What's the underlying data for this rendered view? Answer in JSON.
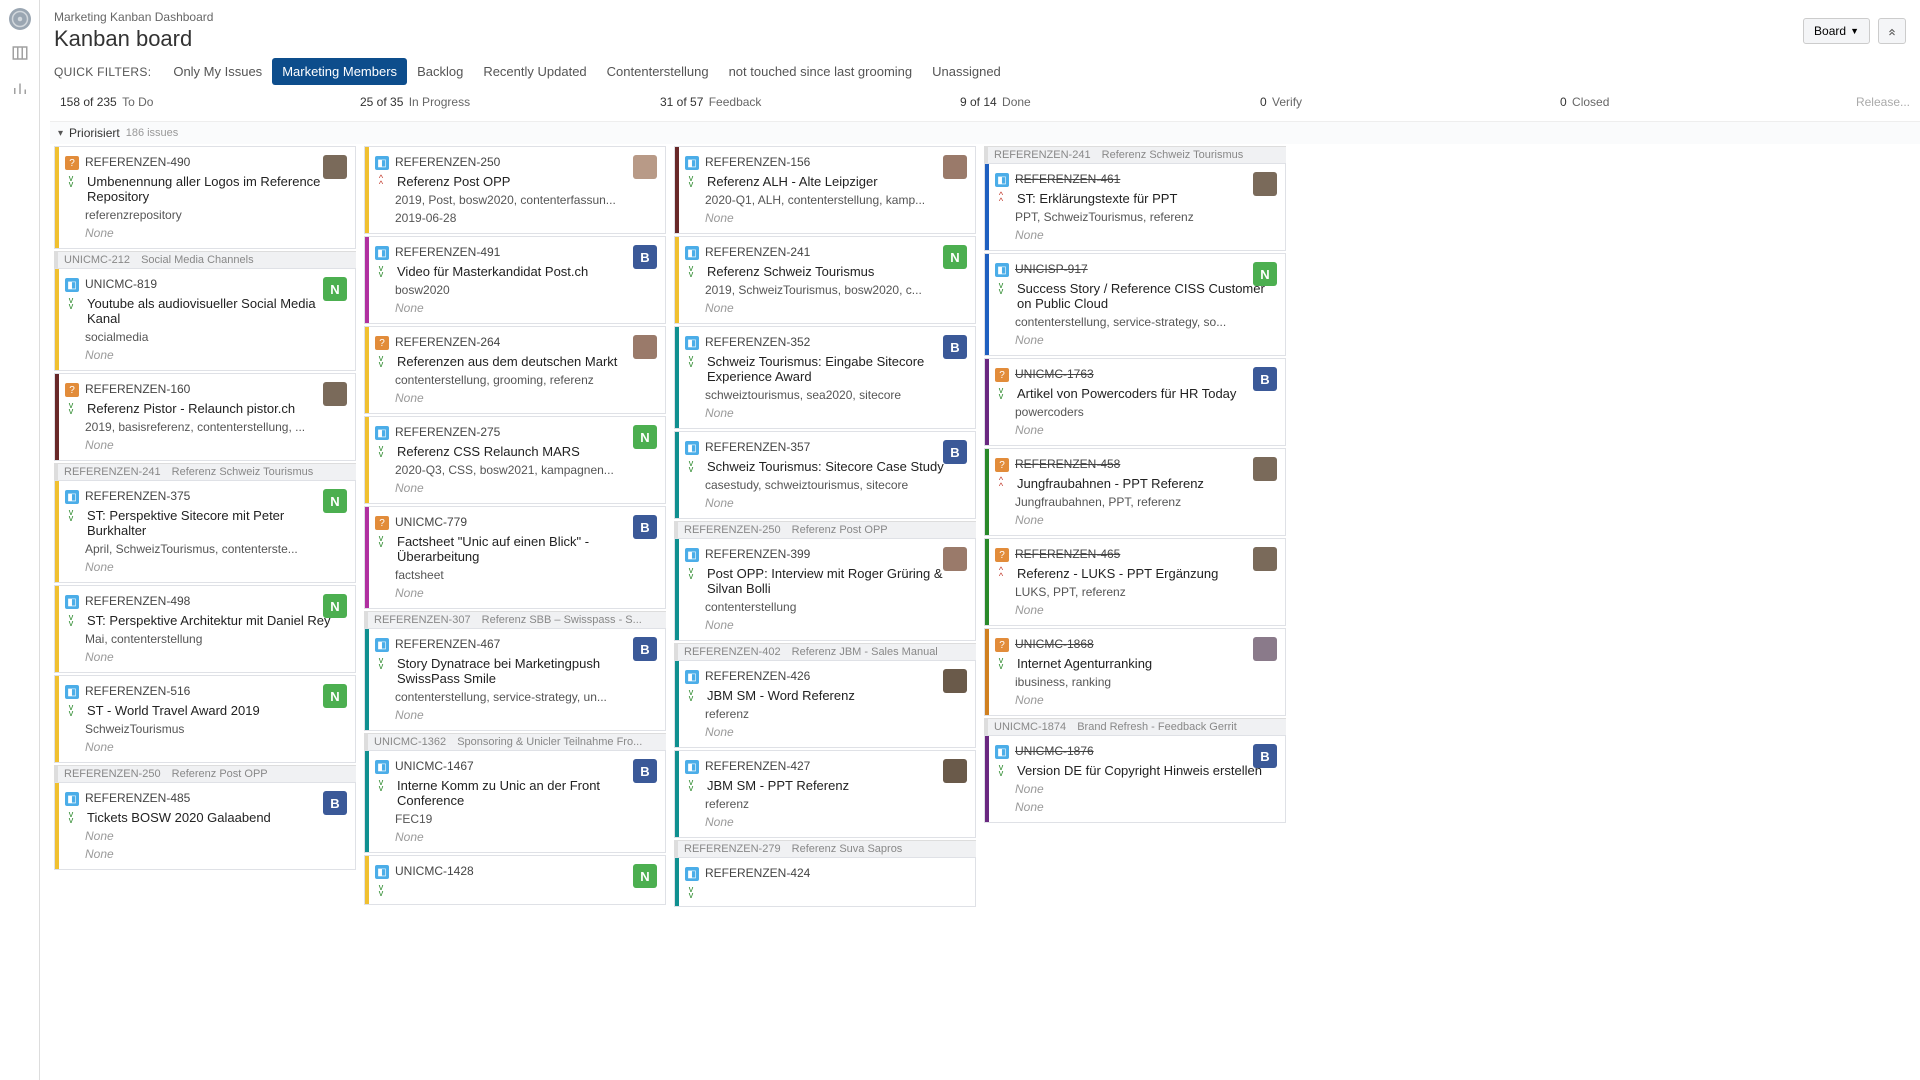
{
  "breadcrumb": "Marketing Kanban Dashboard",
  "page_title": "Kanban board",
  "board_menu": "Board",
  "filters_label": "QUICK FILTERS:",
  "filters": [
    {
      "label": "Only My Issues",
      "active": false
    },
    {
      "label": "Marketing Members",
      "active": true
    },
    {
      "label": "Backlog",
      "active": false
    },
    {
      "label": "Recently Updated",
      "active": false
    },
    {
      "label": "Contenterstellung",
      "active": false
    },
    {
      "label": "not touched since last grooming",
      "active": false
    },
    {
      "label": "Unassigned",
      "active": false
    }
  ],
  "columns": [
    {
      "count": "158 of 235",
      "name": "To Do"
    },
    {
      "count": "25 of 35",
      "name": "In Progress"
    },
    {
      "count": "31 of 57",
      "name": "Feedback"
    },
    {
      "count": "9 of 14",
      "name": "Done"
    },
    {
      "count": "0",
      "name": "Verify"
    },
    {
      "count": "0",
      "name": "Closed"
    }
  ],
  "release": "Release...",
  "swimlane": {
    "title": "Priorisiert",
    "count": "186 issues"
  },
  "cards": {
    "todo": [
      {
        "lane": "lane-yellow",
        "type": "task",
        "key": "REFERENZEN-490",
        "prio": "lowest",
        "summary": "Umbenennung aller Logos im Reference Repository",
        "tags": "referenzrepository",
        "none": "None",
        "avatar": {
          "cls": "photo2",
          "t": ""
        }
      },
      {
        "swimlabel": {
          "key": "UNICMC-212",
          "title": "Social Media Channels"
        },
        "lane": "lane-yellow",
        "type": "story",
        "key": "UNICMC-819",
        "prio": "lowest",
        "summary": "Youtube als audiovisueller Social Media Kanal",
        "tags": "socialmedia",
        "none": "None",
        "avatar": {
          "cls": "letter-N",
          "t": "N"
        }
      },
      {
        "lane": "lane-maroon",
        "type": "task",
        "key": "REFERENZEN-160",
        "prio": "lowest",
        "summary": "Referenz Pistor - Relaunch pistor.ch",
        "tags": "2019, basisreferenz, contenterstellung, ...",
        "none": "None",
        "avatar": {
          "cls": "photo2",
          "t": ""
        }
      },
      {
        "swimlabel": {
          "key": "REFERENZEN-241",
          "title": "Referenz Schweiz Tourismus"
        },
        "lane": "lane-yellow",
        "type": "story",
        "key": "REFERENZEN-375",
        "prio": "lowest",
        "summary": "ST: Perspektive Sitecore mit Peter Burkhalter",
        "tags": "April, SchweizTourismus, contenterste...",
        "none": "None",
        "avatar": {
          "cls": "letter-N",
          "t": "N"
        }
      },
      {
        "lane": "lane-yellow",
        "type": "story",
        "key": "REFERENZEN-498",
        "prio": "lowest",
        "summary": "ST: Perspektive Architektur mit Daniel Rey",
        "tags": "Mai, contenterstellung",
        "none": "None",
        "avatar": {
          "cls": "letter-N",
          "t": "N"
        }
      },
      {
        "lane": "lane-yellow",
        "type": "story",
        "key": "REFERENZEN-516",
        "prio": "lowest",
        "summary": "ST - World Travel Award 2019",
        "tags": "SchweizTourismus",
        "none": "None",
        "avatar": {
          "cls": "letter-N",
          "t": "N"
        }
      },
      {
        "swimlabel": {
          "key": "REFERENZEN-250",
          "title": "Referenz Post OPP"
        },
        "lane": "lane-yellow",
        "type": "story",
        "key": "REFERENZEN-485",
        "prio": "lowest",
        "summary": "Tickets BOSW 2020 Galaabend",
        "tags": "",
        "none": "None",
        "avatar": {
          "cls": "letter-B",
          "t": "B"
        },
        "none2": "None"
      }
    ],
    "inprogress": [
      {
        "lane": "lane-yellow",
        "type": "story",
        "key": "REFERENZEN-250",
        "prio": "highest",
        "summary": "Referenz Post OPP",
        "tags": "2019, Post, bosw2020, contenterfassun...",
        "none": "2019-06-28",
        "avatar": {
          "cls": "photo1",
          "t": ""
        }
      },
      {
        "lane": "lane-magenta",
        "type": "story",
        "key": "REFERENZEN-491",
        "prio": "lowest",
        "summary": "Video für Masterkandidat Post.ch",
        "tags": "bosw2020",
        "none": "None",
        "avatar": {
          "cls": "letter-B",
          "t": "B"
        }
      },
      {
        "lane": "lane-yellow",
        "type": "task",
        "key": "REFERENZEN-264",
        "prio": "lowest",
        "summary": "Referenzen aus dem deutschen Markt",
        "tags": "contenterstellung, grooming, referenz",
        "none": "None",
        "avatar": {
          "cls": "photo3",
          "t": ""
        }
      },
      {
        "lane": "lane-yellow",
        "type": "story",
        "key": "REFERENZEN-275",
        "prio": "lowest",
        "summary": "Referenz CSS Relaunch MARS",
        "tags": "2020-Q3, CSS, bosw2021, kampagnen...",
        "none": "None",
        "avatar": {
          "cls": "letter-N",
          "t": "N"
        }
      },
      {
        "lane": "lane-magenta",
        "type": "task",
        "key": "UNICMC-779",
        "prio": "lowest",
        "summary": "Factsheet \"Unic auf einen Blick\" - Überarbeitung",
        "tags": "factsheet",
        "none": "None",
        "avatar": {
          "cls": "letter-B",
          "t": "B"
        }
      },
      {
        "swimlabel": {
          "key": "REFERENZEN-307",
          "title": "Referenz SBB – Swisspass - S..."
        },
        "lane": "lane-teal",
        "type": "story",
        "key": "REFERENZEN-467",
        "prio": "lowest",
        "summary": "Story Dynatrace bei Marketingpush SwissPass Smile",
        "tags": "contenterstellung, service-strategy, un...",
        "none": "None",
        "avatar": {
          "cls": "letter-B",
          "t": "B"
        }
      },
      {
        "swimlabel": {
          "key": "UNICMC-1362",
          "title": "Sponsoring & Unicler Teilnahme Fro..."
        },
        "lane": "lane-teal",
        "type": "story",
        "key": "UNICMC-1467",
        "prio": "lowest",
        "summary": "Interne Komm zu Unic an der Front Conference",
        "tags": "FEC19",
        "none": "None",
        "avatar": {
          "cls": "letter-B",
          "t": "B"
        }
      },
      {
        "lane": "lane-yellow",
        "type": "story",
        "key": "UNICMC-1428",
        "prio": "lowest",
        "summary": "",
        "tags": "",
        "none": "",
        "avatar": {
          "cls": "letter-N",
          "t": "N"
        }
      }
    ],
    "feedback": [
      {
        "lane": "lane-maroon",
        "type": "story",
        "key": "REFERENZEN-156",
        "prio": "lowest",
        "summary": "Referenz ALH - Alte Leipziger",
        "tags": "2020-Q1, ALH, contenterstellung, kamp...",
        "none": "None",
        "avatar": {
          "cls": "photo3",
          "t": ""
        }
      },
      {
        "lane": "lane-yellow",
        "type": "story",
        "key": "REFERENZEN-241",
        "prio": "lowest",
        "summary": "Referenz Schweiz Tourismus",
        "tags": "2019, SchweizTourismus, bosw2020, c...",
        "none": "None",
        "avatar": {
          "cls": "letter-N",
          "t": "N"
        }
      },
      {
        "lane": "lane-teal",
        "type": "story",
        "key": "REFERENZEN-352",
        "prio": "lowest",
        "summary": "Schweiz Tourismus: Eingabe Sitecore Experience Award",
        "tags": "schweiztourismus, sea2020, sitecore",
        "none": "None",
        "avatar": {
          "cls": "letter-B",
          "t": "B"
        }
      },
      {
        "lane": "lane-teal",
        "type": "story",
        "key": "REFERENZEN-357",
        "prio": "lowest",
        "summary": "Schweiz Tourismus: Sitecore Case Study",
        "tags": "casestudy, schweiztourismus, sitecore",
        "none": "None",
        "avatar": {
          "cls": "letter-B",
          "t": "B"
        }
      },
      {
        "swimlabel": {
          "key": "REFERENZEN-250",
          "title": "Referenz Post OPP"
        },
        "lane": "lane-teal",
        "type": "story",
        "key": "REFERENZEN-399",
        "prio": "lowest",
        "summary": "Post OPP: Interview mit Roger Grüring & Silvan Bolli",
        "tags": "contenterstellung",
        "none": "None",
        "avatar": {
          "cls": "photo3",
          "t": ""
        }
      },
      {
        "swimlabel": {
          "key": "REFERENZEN-402",
          "title": "Referenz JBM - Sales Manual"
        },
        "lane": "lane-teal",
        "type": "story",
        "key": "REFERENZEN-426",
        "prio": "lowest",
        "summary": "JBM SM - Word Referenz",
        "tags": "referenz",
        "none": "None",
        "avatar": {
          "cls": "photo5",
          "t": ""
        }
      },
      {
        "lane": "lane-teal",
        "type": "story",
        "key": "REFERENZEN-427",
        "prio": "lowest",
        "summary": "JBM SM - PPT Referenz",
        "tags": "referenz",
        "none": "None",
        "avatar": {
          "cls": "photo5",
          "t": ""
        }
      },
      {
        "swimlabel": {
          "key": "REFERENZEN-279",
          "title": "Referenz Suva Sapros"
        },
        "lane": "lane-teal",
        "type": "story",
        "key": "REFERENZEN-424",
        "prio": "lowest",
        "summary": "",
        "tags": "",
        "none": ""
      }
    ],
    "done": [
      {
        "swimlabel": {
          "key": "REFERENZEN-241",
          "title": "Referenz Schweiz Tourismus"
        },
        "lane": "lane-blue",
        "type": "story",
        "key": "REFERENZEN-461",
        "done": true,
        "prio": "highest",
        "summary": "ST: Erklärungstexte für PPT",
        "tags": "PPT, SchweizTourismus, referenz",
        "none": "None",
        "avatar": {
          "cls": "photo2",
          "t": ""
        }
      },
      {
        "lane": "lane-blue",
        "type": "story",
        "key": "UNICISP-917",
        "done": true,
        "prio": "lowest",
        "summary": "Success Story / Reference CISS Customer on Public Cloud",
        "tags": "contenterstellung, service-strategy, so...",
        "none": "None",
        "avatar": {
          "cls": "letter-N",
          "t": "N"
        }
      },
      {
        "lane": "lane-purple",
        "type": "task",
        "key": "UNICMC-1763",
        "done": true,
        "prio": "lowest",
        "summary": "Artikel von Powercoders für HR Today",
        "tags": "powercoders",
        "none": "None",
        "avatar": {
          "cls": "letter-B",
          "t": "B"
        }
      },
      {
        "lane": "lane-green",
        "type": "task",
        "key": "REFERENZEN-458",
        "done": true,
        "prio": "highest",
        "summary": "Jungfraubahnen - PPT Referenz",
        "tags": "Jungfraubahnen, PPT, referenz",
        "none": "None",
        "avatar": {
          "cls": "photo2",
          "t": ""
        }
      },
      {
        "lane": "lane-green",
        "type": "task",
        "key": "REFERENZEN-465",
        "done": true,
        "prio": "highest",
        "summary": "Referenz - LUKS - PPT Ergänzung",
        "tags": "LUKS, PPT, referenz",
        "none": "None",
        "avatar": {
          "cls": "photo2",
          "t": ""
        }
      },
      {
        "lane": "lane-orange",
        "type": "task",
        "key": "UNICMC-1868",
        "done": true,
        "prio": "lowest",
        "summary": "Internet Agenturranking",
        "tags": "ibusiness, ranking",
        "none": "None",
        "avatar": {
          "cls": "photo4",
          "t": ""
        }
      },
      {
        "swimlabel": {
          "key": "UNICMC-1874",
          "title": "Brand Refresh - Feedback Gerrit"
        },
        "lane": "lane-purple",
        "type": "story",
        "key": "UNICMC-1876",
        "done": true,
        "prio": "lowest",
        "summary": "Version DE für Copyright Hinweis erstellen",
        "tags": "",
        "none": "None",
        "none2": "None",
        "avatar": {
          "cls": "letter-B",
          "t": "B"
        }
      }
    ]
  }
}
